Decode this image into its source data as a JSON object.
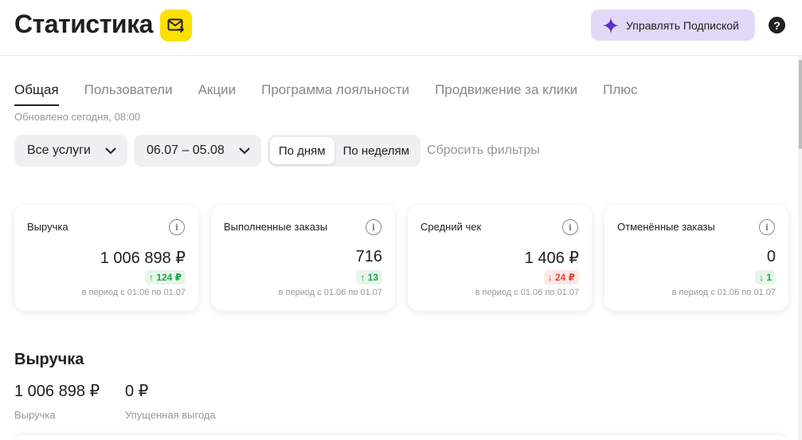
{
  "header": {
    "title": "Статистика",
    "mail_icon": "mail-forward-icon",
    "subscription_button": "Управлять Подпиской",
    "help_label": "?"
  },
  "tabs": [
    {
      "label": "Общая",
      "active": true
    },
    {
      "label": "Пользователи",
      "active": false
    },
    {
      "label": "Акции",
      "active": false
    },
    {
      "label": "Программа лояльности",
      "active": false
    },
    {
      "label": "Продвижение за клики",
      "active": false
    },
    {
      "label": "Плюс",
      "active": false
    }
  ],
  "updated_text": "Обновлено сегодня, 08:00",
  "filters": {
    "services": "Все услуги",
    "date_range": "06.07 – 05.08",
    "by_days": "По дням",
    "by_weeks": "По неделям",
    "reset": "Сбросить фильтры"
  },
  "cards": [
    {
      "title": "Выручка",
      "value": "1 006 898 ₽",
      "delta": "↑ 124 ₽",
      "direction": "up",
      "period": "в период с 01.06 по 01.07"
    },
    {
      "title": "Выполненные заказы",
      "value": "716",
      "delta": "↑ 13",
      "direction": "up",
      "period": "в период с 01.06 по 01.07"
    },
    {
      "title": "Средний чек",
      "value": "1 406 ₽",
      "delta": "↓ 24 ₽",
      "direction": "down",
      "period": "в период с 01.06 по 01.07"
    },
    {
      "title": "Отменённые заказы",
      "value": "0",
      "delta": "↓ 1",
      "direction": "up",
      "period": "в период с 01.06 по 01.07"
    }
  ],
  "revenue": {
    "title": "Выручка",
    "value1": "1 006 898 ₽",
    "label1": "Выручка",
    "value2": "0 ₽",
    "label2": "Упущенная выгода"
  },
  "colors": {
    "accent_yellow": "#fce000",
    "subscription_bg": "#e2d8f7",
    "up_green": "#1ea64a",
    "down_red": "#e2453c"
  }
}
